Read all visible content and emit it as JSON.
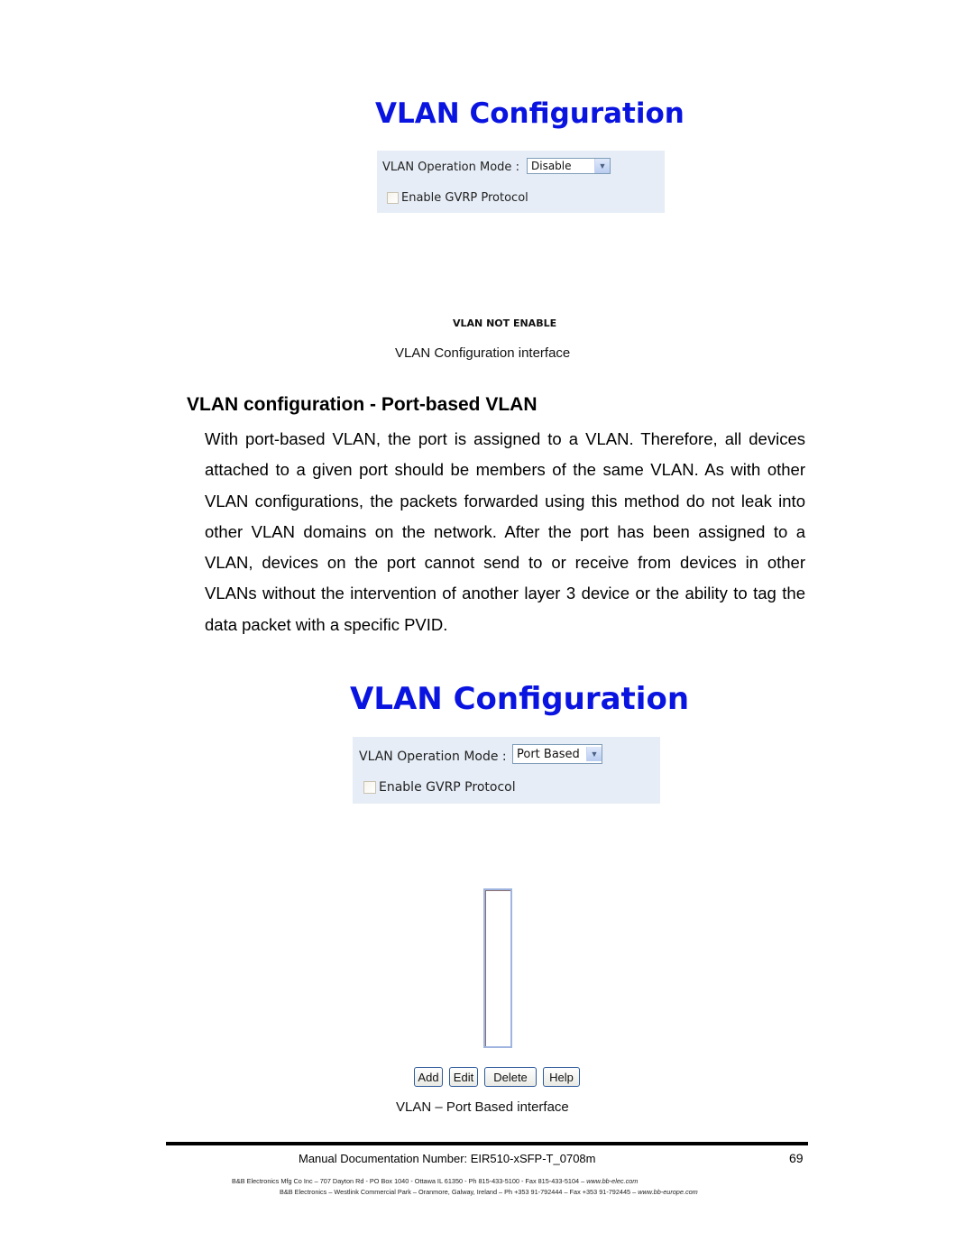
{
  "figure1": {
    "title": "VLAN Configuration",
    "mode_label": "VLAN Operation Mode :",
    "mode_value": "Disable",
    "gvrp_label": "Enable GVRP Protocol",
    "gvrp_checked": false,
    "status_text": "VLAN NOT ENABLE",
    "caption": "VLAN Configuration interface"
  },
  "section": {
    "heading": "VLAN configuration - Port-based VLAN",
    "paragraph": "With port-based VLAN, the port is assigned to a VLAN. Therefore, all devices attached to a given port should be members of the same VLAN. As with other VLAN configurations, the packets forwarded using this method do not leak into other VLAN domains on the network. After the port has been assigned to a VLAN, devices on the port cannot send to or receive from devices in other VLANs without the intervention of another layer 3 device or the ability to tag the data packet with a specific PVID."
  },
  "figure2": {
    "title": "VLAN Configuration",
    "mode_label": "VLAN Operation Mode :",
    "mode_value": "Port Based",
    "gvrp_label": "Enable GVRP Protocol",
    "gvrp_checked": false,
    "buttons": {
      "add": "Add",
      "edit": "Edit",
      "delete": "Delete",
      "help": "Help"
    },
    "caption": "VLAN – Port Based interface"
  },
  "footer": {
    "doc_number": "Manual Documentation Number: EIR510-xSFP-T_0708m",
    "page_number": "69",
    "us_address": "B&B Electronics Mfg Co Inc – 707 Dayton Rd - PO Box 1040 - Ottawa IL 61350 - Ph 815-433-5100 - Fax 815-433-5104 –",
    "us_url": "www.bb-elec.com",
    "eu_address": "B&B Electronics – Westlink Commercial Park – Oranmore, Galway, Ireland – Ph +353 91-792444 – Fax +353 91-792445 –",
    "eu_url": "www.bb-europe.com"
  },
  "icons": {
    "dropdown": "chevron-down-icon"
  }
}
